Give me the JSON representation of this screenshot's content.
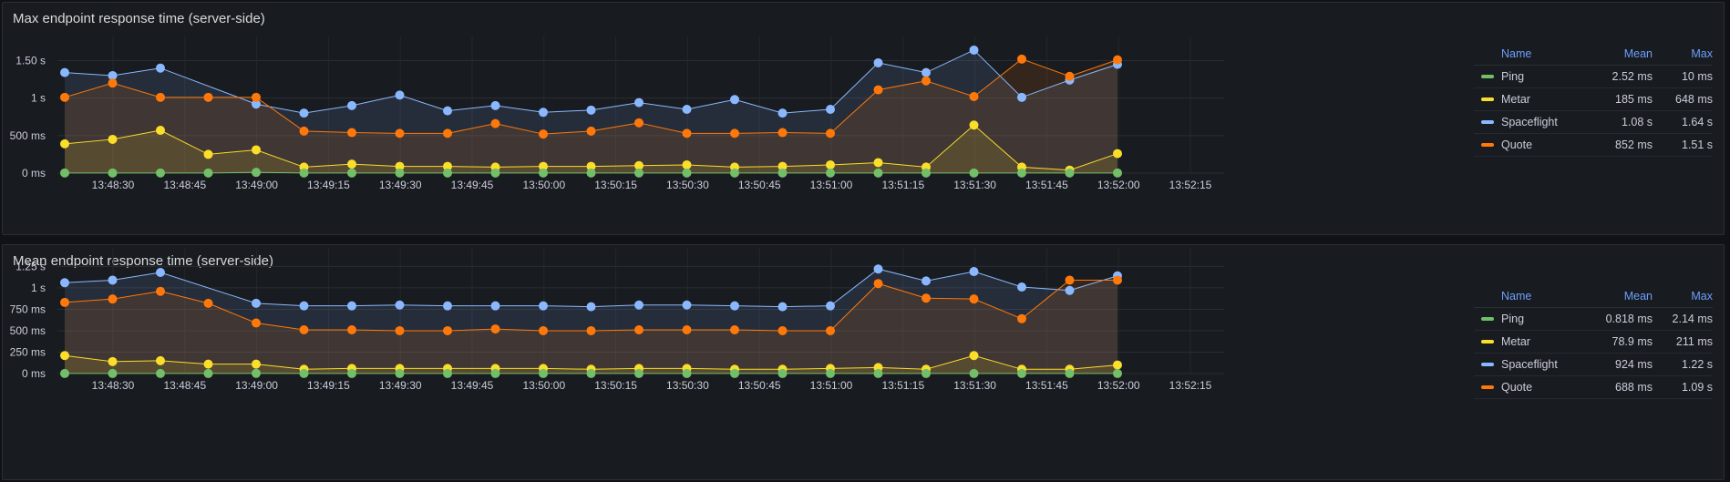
{
  "colors": {
    "Ping": "#73bf69",
    "Metar": "#fade2a",
    "Spaceflight": "#8ab8ff",
    "Quote": "#ff780a"
  },
  "panels": [
    {
      "title": "Max endpoint response time (server-side)",
      "legend": {
        "headers": {
          "name": "Name",
          "mean": "Mean",
          "max": "Max"
        },
        "rows": [
          {
            "name": "Ping",
            "mean": "2.52 ms",
            "max": "10 ms"
          },
          {
            "name": "Metar",
            "mean": "185 ms",
            "max": "648 ms"
          },
          {
            "name": "Spaceflight",
            "mean": "1.08 s",
            "max": "1.64 s"
          },
          {
            "name": "Quote",
            "mean": "852 ms",
            "max": "1.51 s"
          }
        ]
      },
      "chart_data": {
        "type": "line",
        "ylim": [
          0,
          1700
        ],
        "yticks": [
          {
            "v": 0,
            "label": "0 ms"
          },
          {
            "v": 500,
            "label": "500 ms"
          },
          {
            "v": 1000,
            "label": "1 s"
          },
          {
            "v": 1500,
            "label": "1.50 s"
          }
        ],
        "xticks": [
          "13:48:30",
          "13:48:45",
          "13:49:00",
          "13:49:15",
          "13:49:30",
          "13:49:45",
          "13:50:00",
          "13:50:15",
          "13:50:30",
          "13:50:45",
          "13:51:00",
          "13:51:15",
          "13:51:30",
          "13:51:45",
          "13:52:00",
          "13:52:15"
        ],
        "series": [
          {
            "name": "Spaceflight",
            "values": [
              1340,
              1300,
              1400,
              null,
              920,
              800,
              900,
              1040,
              830,
              900,
              810,
              840,
              940,
              850,
              980,
              800,
              850,
              1470,
              1340,
              1640,
              1010,
              1240,
              1450
            ]
          },
          {
            "name": "Quote",
            "values": [
              1010,
              1200,
              1010,
              1010,
              1010,
              560,
              540,
              530,
              530,
              660,
              520,
              560,
              670,
              530,
              530,
              540,
              530,
              1110,
              1230,
              1020,
              1520,
              1290,
              1510
            ]
          },
          {
            "name": "Metar",
            "values": [
              390,
              450,
              570,
              250,
              310,
              80,
              120,
              90,
              90,
              80,
              90,
              90,
              100,
              110,
              80,
              90,
              110,
              140,
              80,
              640,
              80,
              40,
              260
            ]
          },
          {
            "name": "Ping",
            "values": [
              2,
              2,
              2,
              2,
              10,
              2,
              2,
              2,
              2,
              2,
              2,
              2,
              2,
              2,
              2,
              2,
              2,
              2,
              2,
              2,
              2,
              2,
              2
            ]
          }
        ]
      }
    },
    {
      "title": "Mean endpoint response time (server-side)",
      "legend": {
        "headers": {
          "name": "Name",
          "mean": "Mean",
          "max": "Max"
        },
        "rows": [
          {
            "name": "Ping",
            "mean": "0.818 ms",
            "max": "2.14 ms"
          },
          {
            "name": "Metar",
            "mean": "78.9 ms",
            "max": "211 ms"
          },
          {
            "name": "Spaceflight",
            "mean": "924 ms",
            "max": "1.22 s"
          },
          {
            "name": "Quote",
            "mean": "688 ms",
            "max": "1.09 s"
          }
        ]
      },
      "chart_data": {
        "type": "line",
        "ylim": [
          0,
          1350
        ],
        "yticks": [
          {
            "v": 0,
            "label": "0 ms"
          },
          {
            "v": 250,
            "label": "250 ms"
          },
          {
            "v": 500,
            "label": "500 ms"
          },
          {
            "v": 750,
            "label": "750 ms"
          },
          {
            "v": 1000,
            "label": "1 s"
          },
          {
            "v": 1250,
            "label": "1.25 s"
          }
        ],
        "xticks": [
          "13:48:30",
          "13:48:45",
          "13:49:00",
          "13:49:15",
          "13:49:30",
          "13:49:45",
          "13:50:00",
          "13:50:15",
          "13:50:30",
          "13:50:45",
          "13:51:00",
          "13:51:15",
          "13:51:30",
          "13:51:45",
          "13:52:00",
          "13:52:15"
        ],
        "series": [
          {
            "name": "Spaceflight",
            "values": [
              1060,
              1090,
              1180,
              null,
              820,
              790,
              790,
              800,
              790,
              790,
              790,
              780,
              800,
              800,
              790,
              780,
              790,
              1220,
              1080,
              1190,
              1010,
              970,
              1140
            ]
          },
          {
            "name": "Quote",
            "values": [
              830,
              870,
              960,
              820,
              590,
              510,
              510,
              500,
              500,
              520,
              500,
              500,
              510,
              510,
              510,
              500,
              500,
              1050,
              880,
              870,
              640,
              1090,
              1090
            ]
          },
          {
            "name": "Metar",
            "values": [
              210,
              140,
              150,
              110,
              110,
              50,
              60,
              60,
              60,
              60,
              60,
              50,
              60,
              60,
              50,
              50,
              60,
              70,
              50,
              210,
              50,
              50,
              100
            ]
          },
          {
            "name": "Ping",
            "values": [
              1,
              1,
              1,
              1,
              2,
              1,
              1,
              1,
              1,
              1,
              1,
              1,
              1,
              1,
              1,
              1,
              1,
              1,
              1,
              1,
              1,
              1,
              1
            ]
          }
        ]
      }
    }
  ]
}
